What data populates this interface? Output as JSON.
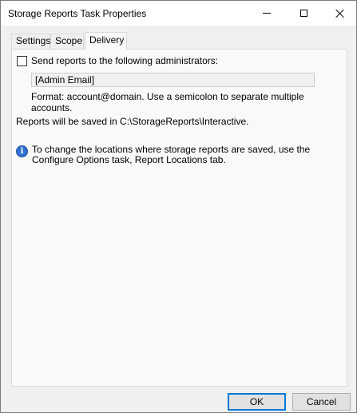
{
  "window": {
    "title": "Storage Reports Task Properties"
  },
  "tabs": [
    {
      "label": "Settings"
    },
    {
      "label": "Scope"
    },
    {
      "label": "Delivery"
    }
  ],
  "delivery": {
    "send_reports_label": "Send reports to the following administrators:",
    "send_reports_checked": false,
    "email_field_value": "[Admin Email]",
    "format_note": "Format: account@domain. Use a semicolon to separate multiple accounts.",
    "saved_location_text": "Reports will be saved in C:\\StorageReports\\Interactive.",
    "info_icon": "info-icon",
    "info_text": "To change the locations where storage reports are saved, use the Configure Options task, Report Locations tab."
  },
  "buttons": {
    "ok": "OK",
    "cancel": "Cancel"
  },
  "colors": {
    "accent": "#0078d7",
    "info_icon": "#2f6fcf"
  }
}
